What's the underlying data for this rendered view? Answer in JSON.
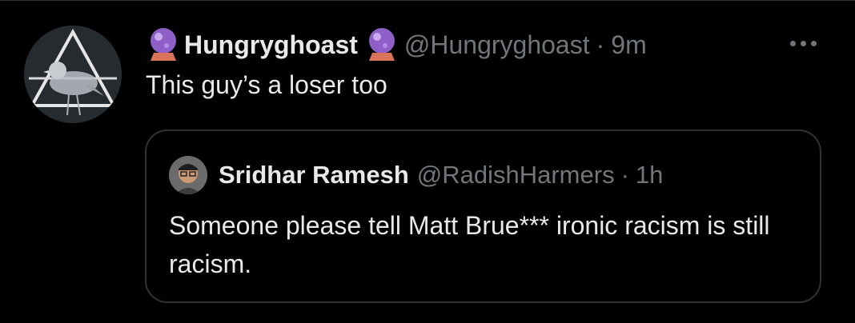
{
  "tweet": {
    "display_name": "Hungryghoast",
    "name_emoji": "crystal-ball-emoji",
    "handle": "@Hungryghoast",
    "separator": "·",
    "time": "9m",
    "text": "This guy’s a loser too",
    "more_icon": "more-options-icon"
  },
  "quoted_tweet": {
    "display_name": "Sridhar Ramesh",
    "handle": "@RadishHarmers",
    "separator": "·",
    "time": "1h",
    "text": "Someone please tell Matt Brue*** ironic racism is still racism."
  },
  "colors": {
    "background": "#000000",
    "primary_text": "#e7e9ea",
    "secondary_text": "#71767b",
    "border": "#2f3336",
    "orb_purple": "#8e5fc7",
    "orb_base": "#d9735a"
  }
}
